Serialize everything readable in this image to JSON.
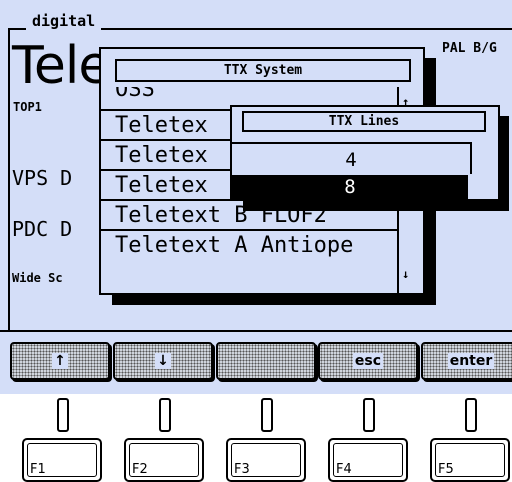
{
  "background": {
    "group_label": "digital",
    "title_partial": "Tele",
    "standard": "PAL B/G",
    "top_label": "TOP1",
    "vps_partial": "VPS D",
    "pdc_partial": "PDC D",
    "wide_partial": "Wide Sc"
  },
  "ttx_system": {
    "title": "TTX System",
    "items": [
      "OSS",
      "Teletex",
      "Teletex",
      "Teletex",
      "Teletext B FLOF2",
      "Teletext A Antiope"
    ],
    "scroll_up": "↑",
    "scroll_down": "↓"
  },
  "ttx_lines": {
    "title": "TTX Lines",
    "items": [
      "4",
      "8"
    ],
    "selected": "8"
  },
  "softkeys": [
    {
      "label": "↑"
    },
    {
      "label": "↓"
    },
    {
      "label": ""
    },
    {
      "label": "esc"
    },
    {
      "label": "enter"
    }
  ],
  "fkeys": [
    "F1",
    "F2",
    "F3",
    "F4",
    "F5"
  ],
  "colors": {
    "screen_bg": "#d4def8",
    "selection_bg": "#000000",
    "selection_fg": "#ffffff"
  }
}
